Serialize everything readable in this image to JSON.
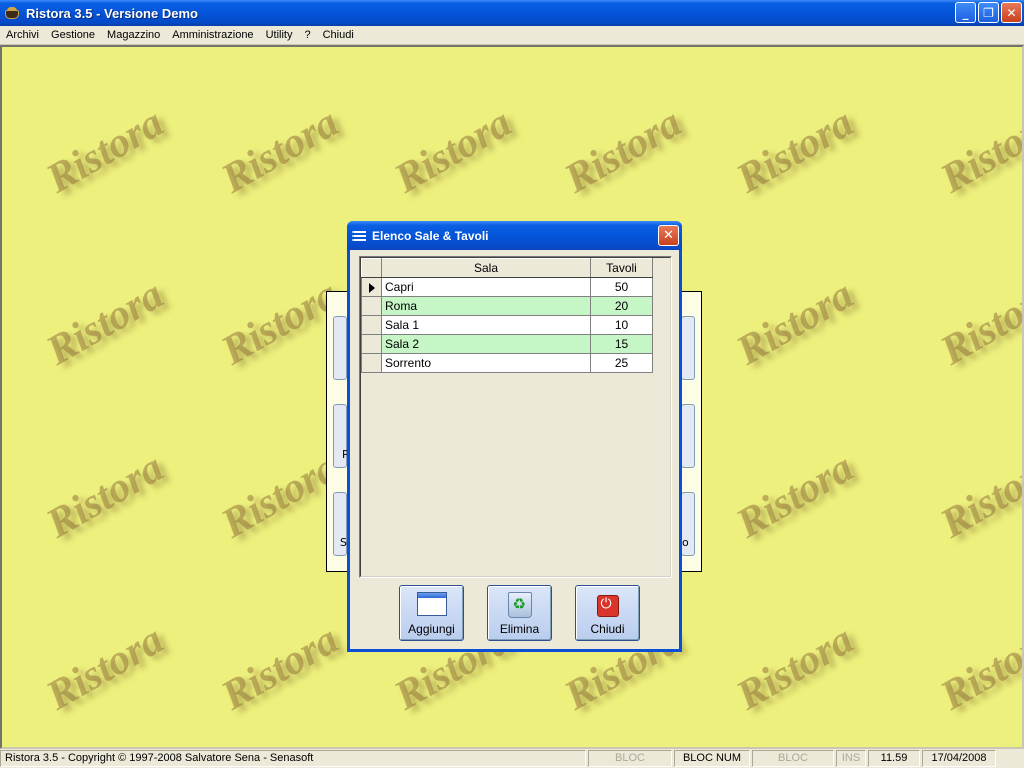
{
  "window": {
    "title": "Ristora 3.5 - Versione Demo",
    "controls": [
      "_",
      "❐",
      "✕"
    ]
  },
  "menu": [
    "Archivi",
    "Gestione",
    "Magazzino",
    "Amministrazione",
    "Utility",
    "?",
    "Chiudi"
  ],
  "watermark": "Ristora",
  "background_tiles": {
    "left": [
      "P",
      "S"
    ],
    "right": [
      "o"
    ]
  },
  "dialog": {
    "title": "Elenco Sale & Tavoli",
    "close": "✕",
    "columns": [
      "Sala",
      "Tavoli"
    ],
    "rows": [
      {
        "sala": "Capri",
        "tavoli": "50",
        "current": true
      },
      {
        "sala": "Roma",
        "tavoli": "20",
        "current": false
      },
      {
        "sala": "Sala 1",
        "tavoli": "10",
        "current": false
      },
      {
        "sala": "Sala 2",
        "tavoli": "15",
        "current": false
      },
      {
        "sala": "Sorrento",
        "tavoli": "25",
        "current": false
      }
    ],
    "buttons": {
      "add": "Aggiungi",
      "delete": "Elimina",
      "close": "Chiudi"
    }
  },
  "statusbar": {
    "copyright": "Ristora 3.5 - Copyright © 1997-2008 Salvatore Sena - Senasoft",
    "caps": "BLOC MAIUSC",
    "num": "BLOC NUM",
    "scroll": "BLOC SCORR",
    "ins": "INS",
    "time": "11.59",
    "date": "17/04/2008"
  },
  "colors": {
    "workspace": "#edf07d",
    "alt_row": "#c6f5c6",
    "titlebar": "#0454d8"
  }
}
